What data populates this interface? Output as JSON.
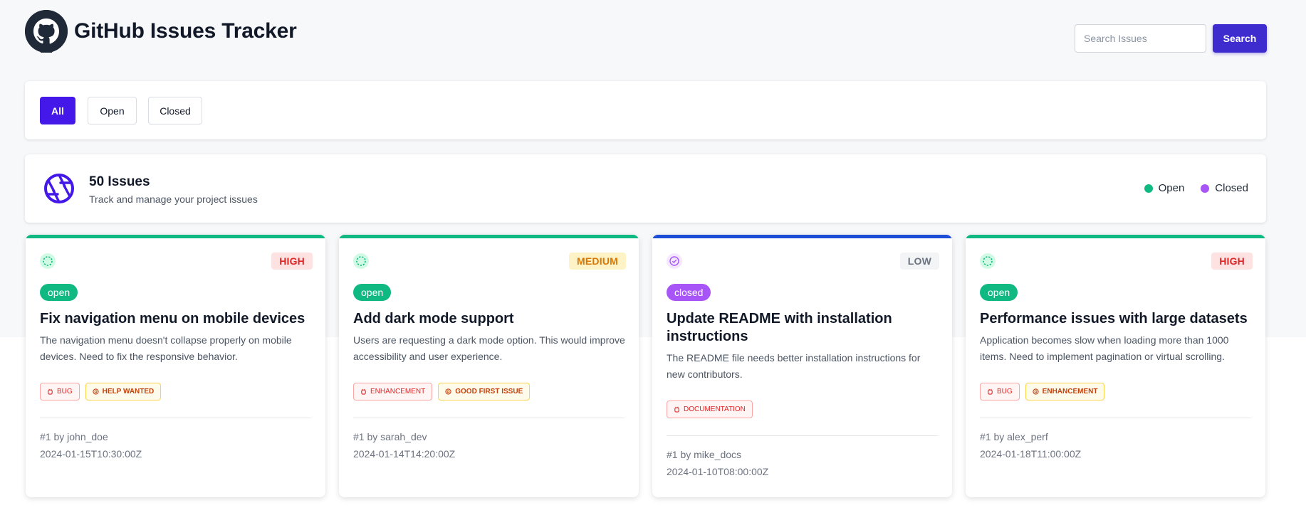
{
  "header": {
    "title": "GitHub Issues Tracker",
    "logo_icon": "github-octocat-icon"
  },
  "search": {
    "placeholder": "Search Issues",
    "value": "",
    "button_label": "Search"
  },
  "filters": {
    "items": [
      {
        "label": "All",
        "active": true
      },
      {
        "label": "Open",
        "active": false
      },
      {
        "label": "Closed",
        "active": false
      }
    ]
  },
  "summary": {
    "count_label": "50 Issues",
    "subtitle": "Track and manage your project issues",
    "icon": "aperture-icon",
    "legend": [
      {
        "label": "Open",
        "color": "#10b981"
      },
      {
        "label": "Closed",
        "color": "#a855f7"
      }
    ]
  },
  "colors": {
    "accent": "#4318e8",
    "open": "#10b981",
    "closed": "#a855f7",
    "high": "#dc2626",
    "medium": "#d97706",
    "low": "#6b7280"
  },
  "issues": [
    {
      "state": "open",
      "priority": "HIGH",
      "title": "Fix navigation menu on mobile devices",
      "description": "The navigation menu doesn't collapse properly on mobile devices. Need to fix the responsive behavior.",
      "labels": [
        {
          "text": "BUG",
          "style": "red",
          "icon": "bug-icon"
        },
        {
          "text": "HELP WANTED",
          "style": "orange",
          "icon": "help-icon"
        }
      ],
      "number_author": "#1 by john_doe",
      "created": "2024-01-15T10:30:00Z"
    },
    {
      "state": "open",
      "priority": "MEDIUM",
      "title": "Add dark mode support",
      "description": "Users are requesting a dark mode option. This would improve accessibility and user experience.",
      "labels": [
        {
          "text": "ENHANCEMENT",
          "style": "red",
          "icon": "bug-icon"
        },
        {
          "text": "GOOD FIRST ISSUE",
          "style": "orange",
          "icon": "help-icon"
        }
      ],
      "number_author": "#1 by sarah_dev",
      "created": "2024-01-14T14:20:00Z"
    },
    {
      "state": "closed",
      "priority": "LOW",
      "title": "Update README with installation instructions",
      "description": "The README file needs better installation instructions for new contributors.",
      "labels": [
        {
          "text": "DOCUMENTATION",
          "style": "red",
          "icon": "bug-icon"
        }
      ],
      "number_author": "#1 by mike_docs",
      "created": "2024-01-10T08:00:00Z"
    },
    {
      "state": "open",
      "priority": "HIGH",
      "title": "Performance issues with large datasets",
      "description": "Application becomes slow when loading more than 1000 items. Need to implement pagination or virtual scrolling.",
      "labels": [
        {
          "text": "BUG",
          "style": "red",
          "icon": "bug-icon"
        },
        {
          "text": "ENHANCEMENT",
          "style": "orange",
          "icon": "help-icon"
        }
      ],
      "number_author": "#1 by alex_perf",
      "created": "2024-01-18T11:00:00Z"
    }
  ]
}
